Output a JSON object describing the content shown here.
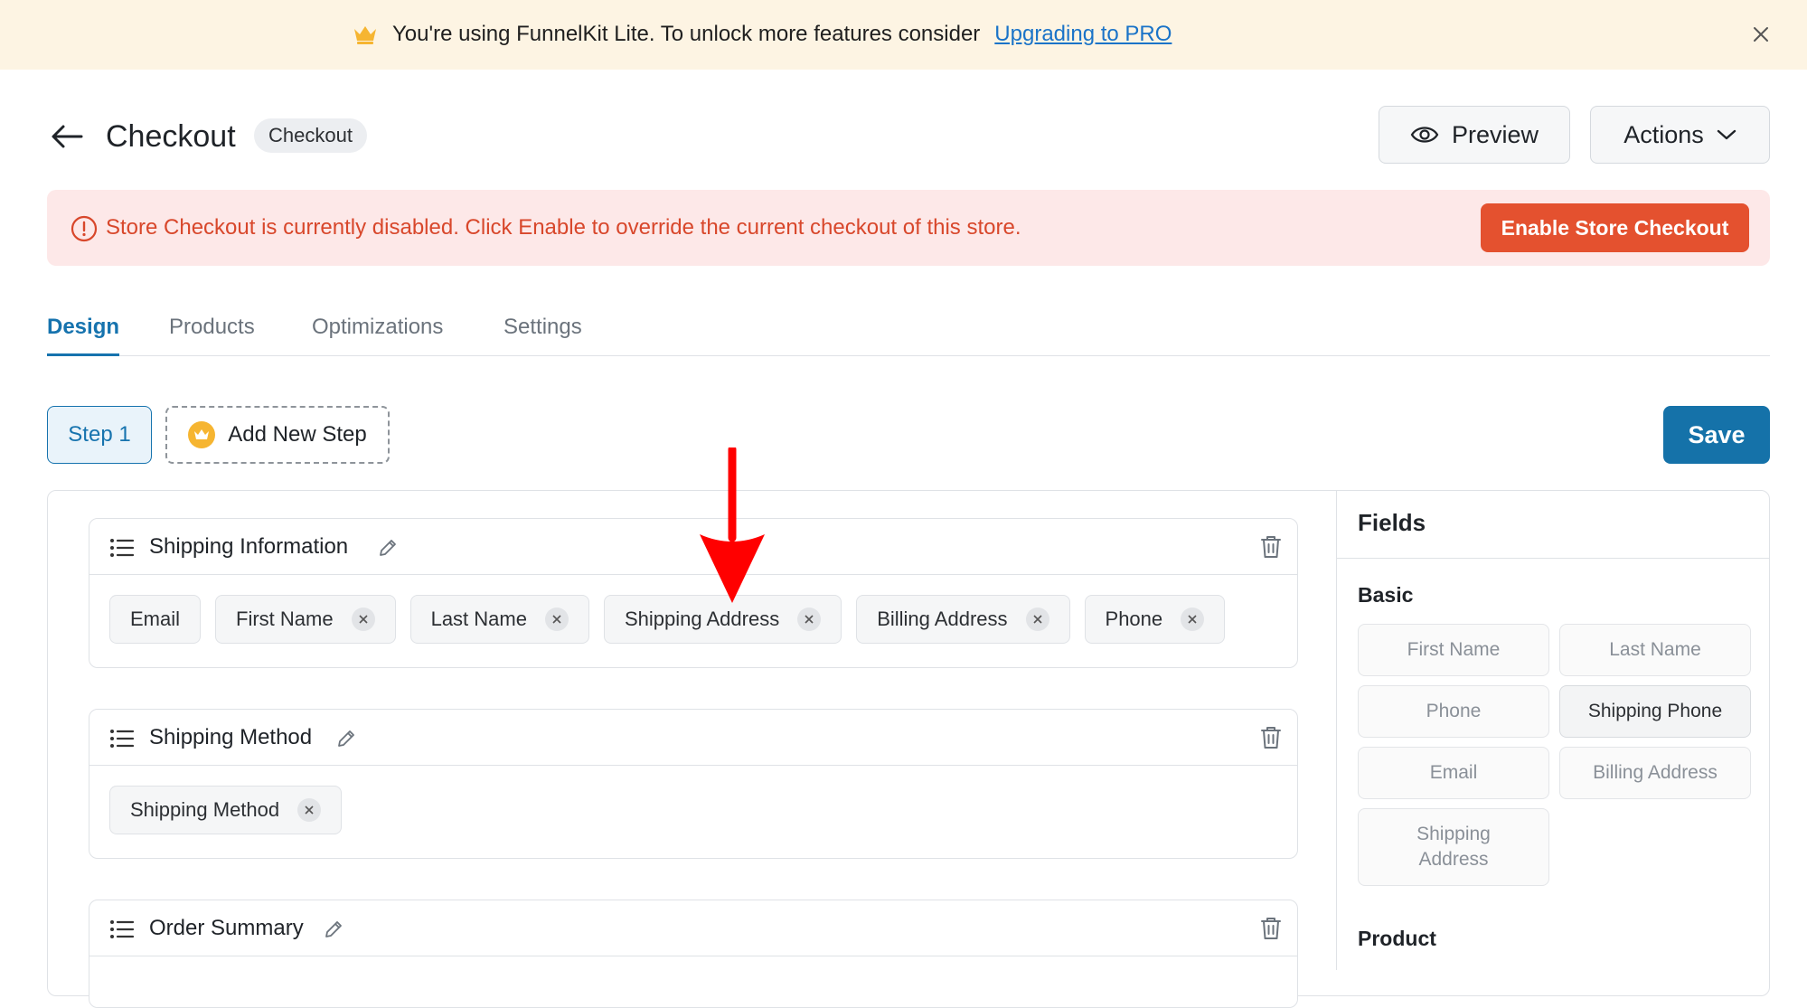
{
  "promo": {
    "text": "You're using FunnelKit Lite. To unlock more features consider",
    "link": "Upgrading to PRO",
    "crown_icon": "crown-icon",
    "close_icon": "close-icon"
  },
  "header": {
    "title": "Checkout",
    "badge": "Checkout",
    "preview_label": "Preview",
    "actions_label": "Actions"
  },
  "alert": {
    "message": "Store Checkout is currently disabled. Click Enable to override the current checkout of this store.",
    "button_label": "Enable Store Checkout",
    "color": "#e4512f"
  },
  "tabs": [
    {
      "label": "Design",
      "active": true
    },
    {
      "label": "Products",
      "active": false
    },
    {
      "label": "Optimizations",
      "active": false
    },
    {
      "label": "Settings",
      "active": false
    }
  ],
  "steps": {
    "current": "Step 1",
    "add_label": "Add New Step",
    "save_label": "Save"
  },
  "sections": [
    {
      "title": "Shipping Information",
      "fields": [
        {
          "label": "Email",
          "removable": false
        },
        {
          "label": "First Name",
          "removable": true
        },
        {
          "label": "Last Name",
          "removable": true
        },
        {
          "label": "Shipping Address",
          "removable": true
        },
        {
          "label": "Billing Address",
          "removable": true
        },
        {
          "label": "Phone",
          "removable": true
        }
      ]
    },
    {
      "title": "Shipping Method",
      "fields": [
        {
          "label": "Shipping Method",
          "removable": true
        }
      ]
    },
    {
      "title": "Order Summary",
      "fields": []
    }
  ],
  "fields_panel": {
    "title": "Fields",
    "basic_title": "Basic",
    "basic": [
      {
        "label": "First Name",
        "used": false
      },
      {
        "label": "Last Name",
        "used": false
      },
      {
        "label": "Phone",
        "used": false
      },
      {
        "label": "Shipping Phone",
        "used": true
      },
      {
        "label": "Email",
        "used": false
      },
      {
        "label": "Billing Address",
        "used": false
      },
      {
        "label": "Shipping Address",
        "used": false
      }
    ],
    "product_title": "Product"
  },
  "colors": {
    "primary": "#1572a9",
    "danger": "#e4512f",
    "annotation": "#ff0000"
  }
}
